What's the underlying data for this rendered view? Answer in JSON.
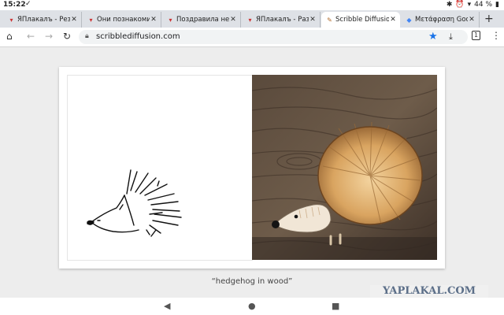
{
  "status": {
    "time": "15:22",
    "battery": "44 %"
  },
  "tabs": [
    {
      "title": "ЯПлакалъ - Резу",
      "active": false
    },
    {
      "title": "Они познакомил",
      "active": false
    },
    {
      "title": "Поздравила не с",
      "active": false
    },
    {
      "title": "ЯПлакалъ - Разд",
      "active": false
    },
    {
      "title": "Scribble Diffusion",
      "active": true
    },
    {
      "title": "Μετάφραση Goo",
      "active": false
    }
  ],
  "address": {
    "url": "scribblediffusion.com"
  },
  "toolbar": {
    "tab_count": "1"
  },
  "prompt": {
    "text": "“hedgehog in wood”"
  },
  "watermark": {
    "text": "YAPLAKAL.COM"
  },
  "colors": {
    "accent": "#1a73e8",
    "tabstrip": "#dee1e6",
    "page": "#ededed"
  }
}
